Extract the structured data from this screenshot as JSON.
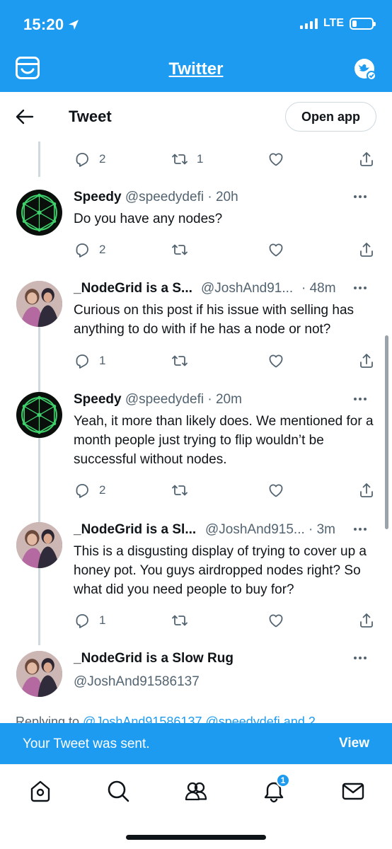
{
  "status": {
    "time": "15:20",
    "network": "LTE"
  },
  "browser": {
    "title": "Twitter"
  },
  "header": {
    "title": "Tweet",
    "open_app_label": "Open app"
  },
  "top_actions": {
    "replies": "2",
    "retweets": "1"
  },
  "tweets": [
    {
      "name": "Speedy",
      "handle": "@speedydefi",
      "time": "· 20h",
      "text": "Do you have any nodes?",
      "replies": "2"
    },
    {
      "name": "_NodeGrid is a S...",
      "handle": "@JoshAnd91...",
      "time": "· 48m",
      "text": "Curious on this post if his issue with selling has anything to do with if he has a node or not?",
      "replies": "1"
    },
    {
      "name": "Speedy",
      "handle": "@speedydefi",
      "time": "· 20m",
      "text": "Yeah, it more than likely does. We mentioned for a month people just trying to flip wouldn’t be successful without nodes.",
      "replies": "2"
    },
    {
      "name": "_NodeGrid is a Sl...",
      "handle": "@JoshAnd915...",
      "time": "· 3m",
      "text": "This is a disgusting display of trying to cover up a honey pot. You guys airdropped nodes right? So what did you need people to buy for?",
      "replies": "1"
    },
    {
      "name": "_NodeGrid is a Slow Rug",
      "handle": "@JoshAnd91586137"
    }
  ],
  "replying": {
    "prefix": "Replying to ",
    "mentions": "@JoshAnd91586137 @speedydefi and 2"
  },
  "toast": {
    "message": "Your Tweet was sent.",
    "action": "View"
  },
  "nav": {
    "notification_count": "1"
  },
  "colors": {
    "accent": "#1d9bf0",
    "text": "#0f1419",
    "muted": "#536471"
  },
  "icons": [
    "location-arrow-icon",
    "signal-icon",
    "battery-icon",
    "tab-icon",
    "profile-badge-icon",
    "back-arrow-icon",
    "reply-icon",
    "retweet-icon",
    "like-icon",
    "share-icon",
    "more-icon",
    "home-icon",
    "search-icon",
    "communities-icon",
    "bell-icon",
    "mail-icon"
  ]
}
